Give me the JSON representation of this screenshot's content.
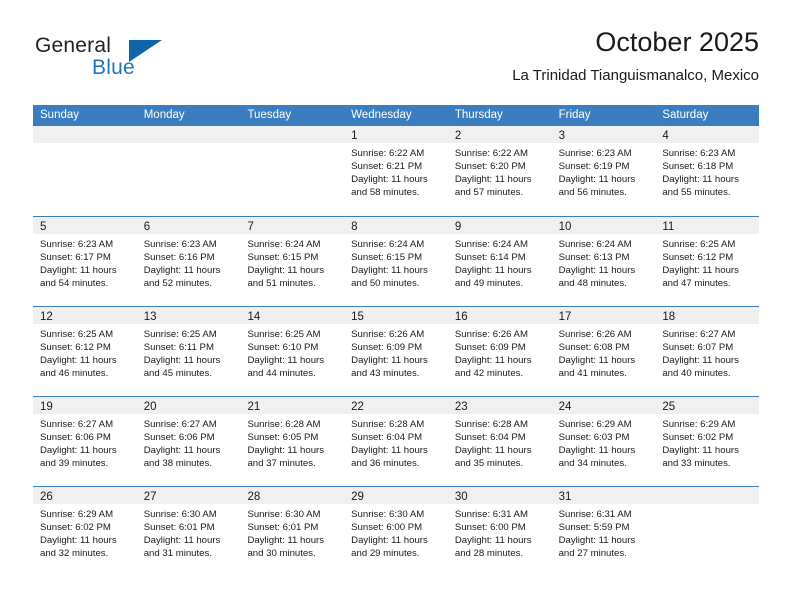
{
  "brand": {
    "name_top": "General",
    "name_bottom": "Blue",
    "triangle_color": "#1065a8",
    "blue_text_color": "#1f77bd"
  },
  "header": {
    "title": "October 2025",
    "subtitle": "La Trinidad Tianguismanalco, Mexico"
  },
  "colors": {
    "header_row_bg": "#3b7ec0",
    "day_band_bg": "#f0f0f0",
    "cell_bg": "#ffffff",
    "text": "#1a1a1a"
  },
  "weekdays": [
    "Sunday",
    "Monday",
    "Tuesday",
    "Wednesday",
    "Thursday",
    "Friday",
    "Saturday"
  ],
  "weeks": [
    [
      {
        "day": "",
        "sunrise": "",
        "sunset": "",
        "daylight_line1": "",
        "daylight_line2": ""
      },
      {
        "day": "",
        "sunrise": "",
        "sunset": "",
        "daylight_line1": "",
        "daylight_line2": ""
      },
      {
        "day": "",
        "sunrise": "",
        "sunset": "",
        "daylight_line1": "",
        "daylight_line2": ""
      },
      {
        "day": "1",
        "sunrise": "Sunrise: 6:22 AM",
        "sunset": "Sunset: 6:21 PM",
        "daylight_line1": "Daylight: 11 hours",
        "daylight_line2": "and 58 minutes."
      },
      {
        "day": "2",
        "sunrise": "Sunrise: 6:22 AM",
        "sunset": "Sunset: 6:20 PM",
        "daylight_line1": "Daylight: 11 hours",
        "daylight_line2": "and 57 minutes."
      },
      {
        "day": "3",
        "sunrise": "Sunrise: 6:23 AM",
        "sunset": "Sunset: 6:19 PM",
        "daylight_line1": "Daylight: 11 hours",
        "daylight_line2": "and 56 minutes."
      },
      {
        "day": "4",
        "sunrise": "Sunrise: 6:23 AM",
        "sunset": "Sunset: 6:18 PM",
        "daylight_line1": "Daylight: 11 hours",
        "daylight_line2": "and 55 minutes."
      }
    ],
    [
      {
        "day": "5",
        "sunrise": "Sunrise: 6:23 AM",
        "sunset": "Sunset: 6:17 PM",
        "daylight_line1": "Daylight: 11 hours",
        "daylight_line2": "and 54 minutes."
      },
      {
        "day": "6",
        "sunrise": "Sunrise: 6:23 AM",
        "sunset": "Sunset: 6:16 PM",
        "daylight_line1": "Daylight: 11 hours",
        "daylight_line2": "and 52 minutes."
      },
      {
        "day": "7",
        "sunrise": "Sunrise: 6:24 AM",
        "sunset": "Sunset: 6:15 PM",
        "daylight_line1": "Daylight: 11 hours",
        "daylight_line2": "and 51 minutes."
      },
      {
        "day": "8",
        "sunrise": "Sunrise: 6:24 AM",
        "sunset": "Sunset: 6:15 PM",
        "daylight_line1": "Daylight: 11 hours",
        "daylight_line2": "and 50 minutes."
      },
      {
        "day": "9",
        "sunrise": "Sunrise: 6:24 AM",
        "sunset": "Sunset: 6:14 PM",
        "daylight_line1": "Daylight: 11 hours",
        "daylight_line2": "and 49 minutes."
      },
      {
        "day": "10",
        "sunrise": "Sunrise: 6:24 AM",
        "sunset": "Sunset: 6:13 PM",
        "daylight_line1": "Daylight: 11 hours",
        "daylight_line2": "and 48 minutes."
      },
      {
        "day": "11",
        "sunrise": "Sunrise: 6:25 AM",
        "sunset": "Sunset: 6:12 PM",
        "daylight_line1": "Daylight: 11 hours",
        "daylight_line2": "and 47 minutes."
      }
    ],
    [
      {
        "day": "12",
        "sunrise": "Sunrise: 6:25 AM",
        "sunset": "Sunset: 6:12 PM",
        "daylight_line1": "Daylight: 11 hours",
        "daylight_line2": "and 46 minutes."
      },
      {
        "day": "13",
        "sunrise": "Sunrise: 6:25 AM",
        "sunset": "Sunset: 6:11 PM",
        "daylight_line1": "Daylight: 11 hours",
        "daylight_line2": "and 45 minutes."
      },
      {
        "day": "14",
        "sunrise": "Sunrise: 6:25 AM",
        "sunset": "Sunset: 6:10 PM",
        "daylight_line1": "Daylight: 11 hours",
        "daylight_line2": "and 44 minutes."
      },
      {
        "day": "15",
        "sunrise": "Sunrise: 6:26 AM",
        "sunset": "Sunset: 6:09 PM",
        "daylight_line1": "Daylight: 11 hours",
        "daylight_line2": "and 43 minutes."
      },
      {
        "day": "16",
        "sunrise": "Sunrise: 6:26 AM",
        "sunset": "Sunset: 6:09 PM",
        "daylight_line1": "Daylight: 11 hours",
        "daylight_line2": "and 42 minutes."
      },
      {
        "day": "17",
        "sunrise": "Sunrise: 6:26 AM",
        "sunset": "Sunset: 6:08 PM",
        "daylight_line1": "Daylight: 11 hours",
        "daylight_line2": "and 41 minutes."
      },
      {
        "day": "18",
        "sunrise": "Sunrise: 6:27 AM",
        "sunset": "Sunset: 6:07 PM",
        "daylight_line1": "Daylight: 11 hours",
        "daylight_line2": "and 40 minutes."
      }
    ],
    [
      {
        "day": "19",
        "sunrise": "Sunrise: 6:27 AM",
        "sunset": "Sunset: 6:06 PM",
        "daylight_line1": "Daylight: 11 hours",
        "daylight_line2": "and 39 minutes."
      },
      {
        "day": "20",
        "sunrise": "Sunrise: 6:27 AM",
        "sunset": "Sunset: 6:06 PM",
        "daylight_line1": "Daylight: 11 hours",
        "daylight_line2": "and 38 minutes."
      },
      {
        "day": "21",
        "sunrise": "Sunrise: 6:28 AM",
        "sunset": "Sunset: 6:05 PM",
        "daylight_line1": "Daylight: 11 hours",
        "daylight_line2": "and 37 minutes."
      },
      {
        "day": "22",
        "sunrise": "Sunrise: 6:28 AM",
        "sunset": "Sunset: 6:04 PM",
        "daylight_line1": "Daylight: 11 hours",
        "daylight_line2": "and 36 minutes."
      },
      {
        "day": "23",
        "sunrise": "Sunrise: 6:28 AM",
        "sunset": "Sunset: 6:04 PM",
        "daylight_line1": "Daylight: 11 hours",
        "daylight_line2": "and 35 minutes."
      },
      {
        "day": "24",
        "sunrise": "Sunrise: 6:29 AM",
        "sunset": "Sunset: 6:03 PM",
        "daylight_line1": "Daylight: 11 hours",
        "daylight_line2": "and 34 minutes."
      },
      {
        "day": "25",
        "sunrise": "Sunrise: 6:29 AM",
        "sunset": "Sunset: 6:02 PM",
        "daylight_line1": "Daylight: 11 hours",
        "daylight_line2": "and 33 minutes."
      }
    ],
    [
      {
        "day": "26",
        "sunrise": "Sunrise: 6:29 AM",
        "sunset": "Sunset: 6:02 PM",
        "daylight_line1": "Daylight: 11 hours",
        "daylight_line2": "and 32 minutes."
      },
      {
        "day": "27",
        "sunrise": "Sunrise: 6:30 AM",
        "sunset": "Sunset: 6:01 PM",
        "daylight_line1": "Daylight: 11 hours",
        "daylight_line2": "and 31 minutes."
      },
      {
        "day": "28",
        "sunrise": "Sunrise: 6:30 AM",
        "sunset": "Sunset: 6:01 PM",
        "daylight_line1": "Daylight: 11 hours",
        "daylight_line2": "and 30 minutes."
      },
      {
        "day": "29",
        "sunrise": "Sunrise: 6:30 AM",
        "sunset": "Sunset: 6:00 PM",
        "daylight_line1": "Daylight: 11 hours",
        "daylight_line2": "and 29 minutes."
      },
      {
        "day": "30",
        "sunrise": "Sunrise: 6:31 AM",
        "sunset": "Sunset: 6:00 PM",
        "daylight_line1": "Daylight: 11 hours",
        "daylight_line2": "and 28 minutes."
      },
      {
        "day": "31",
        "sunrise": "Sunrise: 6:31 AM",
        "sunset": "Sunset: 5:59 PM",
        "daylight_line1": "Daylight: 11 hours",
        "daylight_line2": "and 27 minutes."
      },
      {
        "day": "",
        "sunrise": "",
        "sunset": "",
        "daylight_line1": "",
        "daylight_line2": ""
      }
    ]
  ]
}
